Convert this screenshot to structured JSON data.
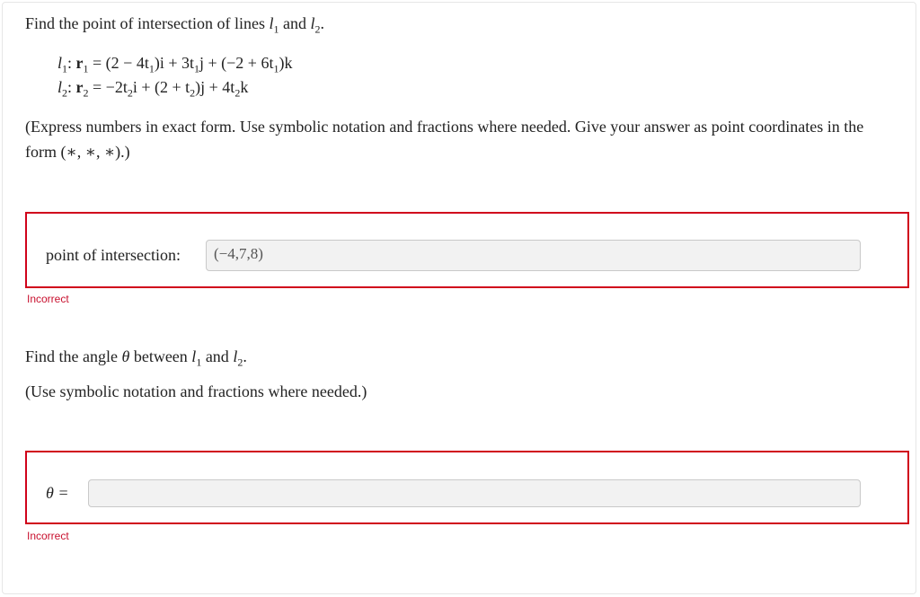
{
  "question1": {
    "prompt_prefix": "Find the point of intersection of lines",
    "line1_name": "l",
    "line1_sub": "1",
    "and_word": "and",
    "line2_name": "l",
    "line2_sub": "2",
    "period": ".",
    "eq1": {
      "lhs": "l",
      "lhs_sub": "1",
      "r": "r",
      "r_sub": "1",
      "rhs": "= (2 − 4t",
      "rhs_sub1": "1",
      "rhs_mid1": ")i + 3t",
      "rhs_sub2": "1",
      "rhs_mid2": "j + (−2 + 6t",
      "rhs_sub3": "1",
      "rhs_end": ")k"
    },
    "eq2": {
      "lhs": "l",
      "lhs_sub": "2",
      "r": "r",
      "r_sub": "2",
      "rhs": "= −2t",
      "rhs_sub1": "2",
      "rhs_mid1": "i + (2 + t",
      "rhs_sub2": "2",
      "rhs_mid2": ")j + 4t",
      "rhs_sub3": "2",
      "rhs_end": "k"
    },
    "instructions": "(Express numbers in exact form. Use symbolic notation and fractions where needed. Give your answer as point coordinates in the form (∗, ∗, ∗).)",
    "answer_label": "point of intersection:",
    "answer_value": "(−4,7,8)",
    "feedback": "Incorrect"
  },
  "question2": {
    "prompt_prefix": "Find the angle",
    "theta": "θ",
    "between_word": "between",
    "line1_name": "l",
    "line1_sub": "1",
    "and_word": "and",
    "line2_name": "l",
    "line2_sub": "2",
    "period": ".",
    "instructions": "(Use symbolic notation and fractions where needed.)",
    "answer_label": "θ =",
    "answer_value": "",
    "feedback": "Incorrect"
  },
  "colors": {
    "error": "#d0021b",
    "field_bg": "#f2f2f2"
  }
}
